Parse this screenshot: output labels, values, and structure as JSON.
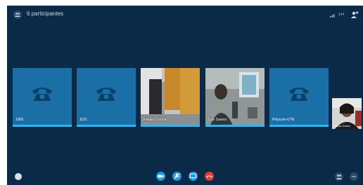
{
  "header": {
    "participants_label": "6 participantes",
    "quality_label": "144"
  },
  "tiles": [
    {
      "name": "1005",
      "kind": "phone"
    },
    {
      "name": "1101",
      "kind": "phone"
    },
    {
      "name": "Fabián Cuzme",
      "kind": "video"
    },
    {
      "name": "Luis Suarez",
      "kind": "video"
    },
    {
      "name": "Polycom-UTN",
      "kind": "phone"
    }
  ],
  "self_view": {
    "name": "Ghicia Guera"
  },
  "controls": {
    "video_icon": "video-camera-icon",
    "mic_icon": "microphone-muted-icon",
    "share_icon": "screen-share-icon",
    "hangup_icon": "hang-up-icon"
  },
  "colors": {
    "background": "#0b2a48",
    "tile": "#1a6fa6",
    "active_bar": "#2fb6f0",
    "control_blue": "#1e9be0",
    "hangup_red": "#e53935"
  }
}
